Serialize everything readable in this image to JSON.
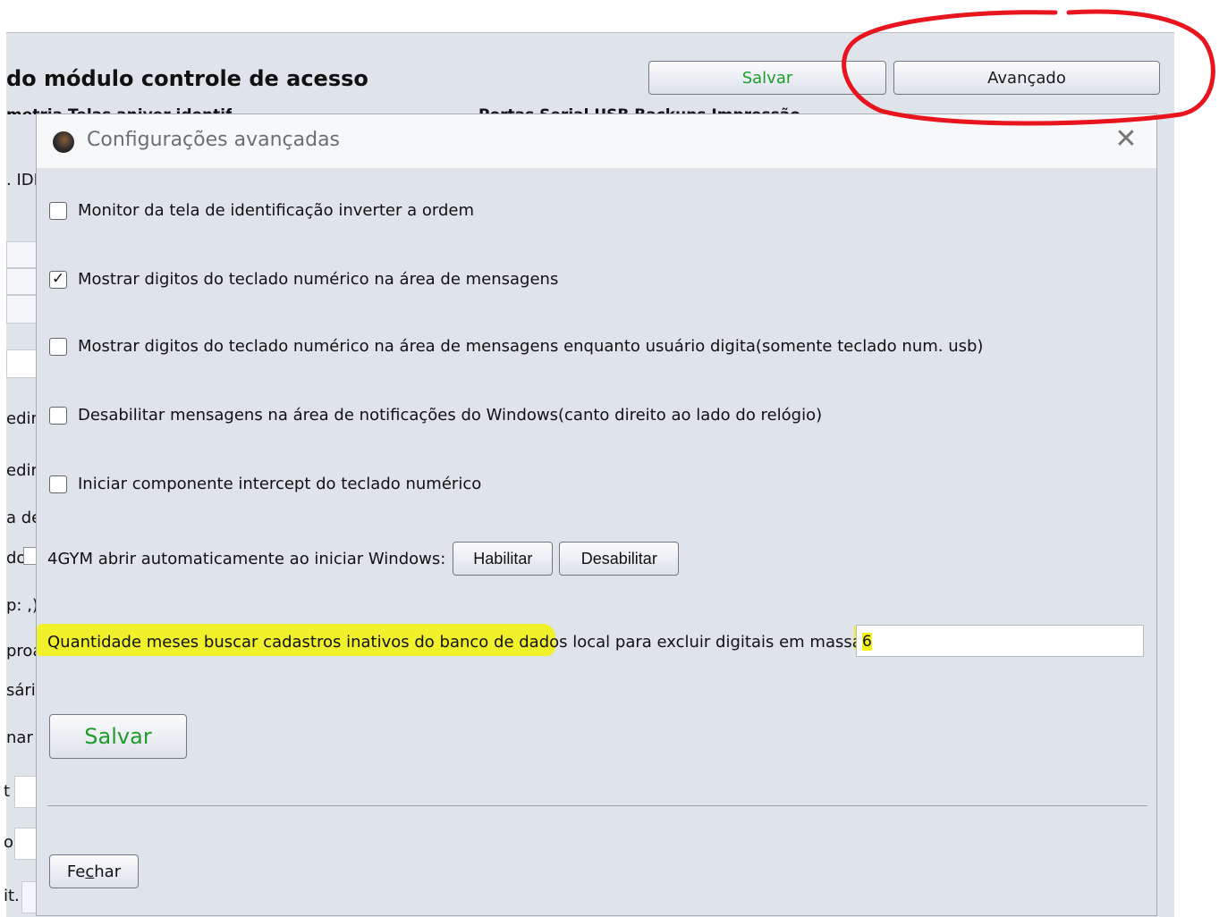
{
  "background": {
    "title": "do módulo controle de acesso",
    "subtitle_left": "metria  Telas aniver  identif",
    "subtitle_right": "Portas Serial  USB  Backups  Impressão",
    "salvar_label": "Salvar",
    "avancado_label": "Avançado",
    "left_fragments": [
      ". IDI",
      "edir :",
      "edir i",
      "a de",
      "do",
      "p: ,)",
      "proa",
      "sári",
      "nar i",
      "t",
      "o",
      "it."
    ]
  },
  "dialog": {
    "title": "Configurações avançadas",
    "close_glyph": "✕",
    "options": [
      {
        "label": "Monitor da tela de identificação inverter a ordem",
        "checked": false
      },
      {
        "label": "Mostrar digitos do teclado numérico na área de mensagens",
        "checked": true
      },
      {
        "label": "Mostrar digitos do teclado numérico na área de mensagens enquanto usuário digita(somente teclado num. usb)",
        "checked": false
      },
      {
        "label": "Desabilitar mensagens na área de notificações do Windows(canto direito ao lado do relógio)",
        "checked": false
      },
      {
        "label": "Iniciar componente intercept do teclado numérico",
        "checked": false
      }
    ],
    "check_glyph": "✓",
    "autostart_label": "4GYM abrir automaticamente ao iniciar Windows:",
    "habilitar_label": "Habilitar",
    "desabilitar_label": "Desabilitar",
    "qty_label": "Quantidade meses buscar cadastros inativos do banco de dados local para excluir digitais em massa:",
    "qty_value": "6",
    "salvar_label": "Salvar",
    "fechar_pre": "Fe",
    "fechar_mnemonic": "c",
    "fechar_post": "har"
  },
  "colors": {
    "salvar_text": "#1e9c2c",
    "annotation_red": "#e8141e",
    "highlight_yellow": "#f2f215"
  }
}
